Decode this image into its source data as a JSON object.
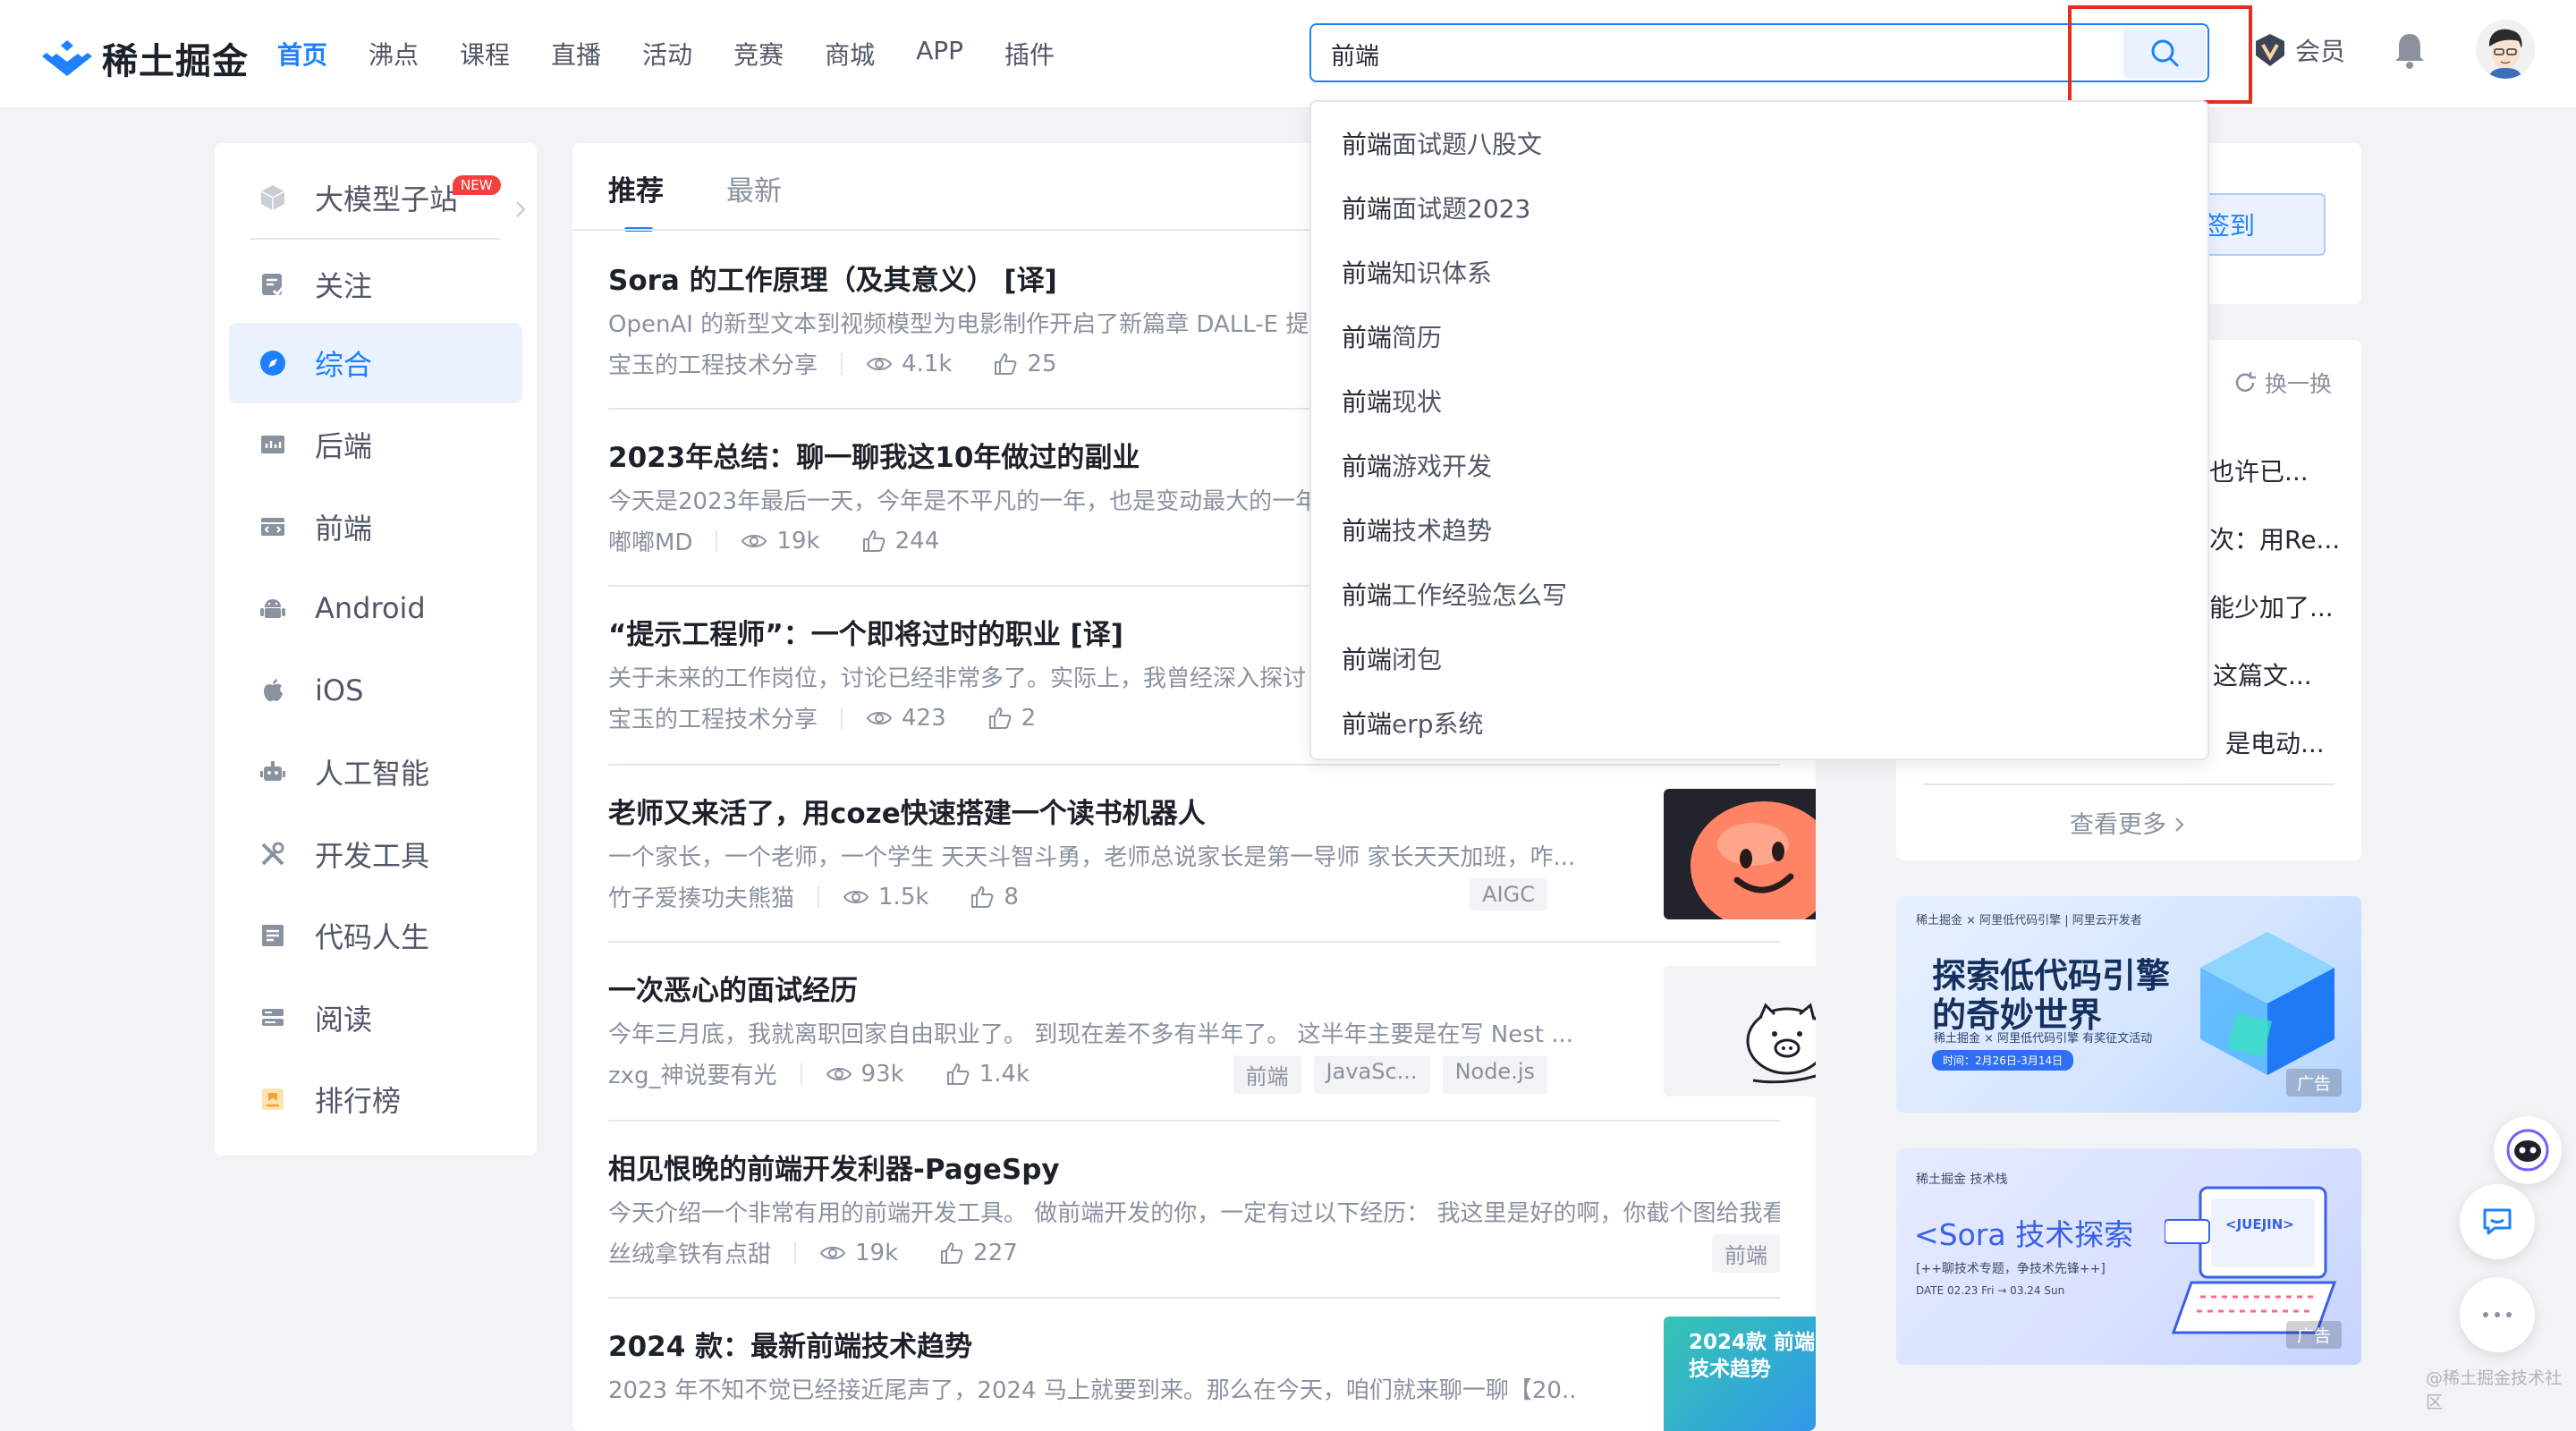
{
  "brand": {
    "name": "稀土掘金",
    "accent": "#1e80ff"
  },
  "nav": {
    "items": [
      {
        "label": "首页",
        "active": true
      },
      {
        "label": "沸点"
      },
      {
        "label": "课程"
      },
      {
        "label": "直播"
      },
      {
        "label": "活动"
      },
      {
        "label": "竞赛"
      },
      {
        "label": "商城"
      },
      {
        "label": "APP"
      },
      {
        "label": "插件"
      }
    ],
    "vip_label": "会员"
  },
  "search": {
    "value": "前端"
  },
  "suggestions": [
    {
      "prefix": "前端",
      "rest": "面试题八股文"
    },
    {
      "prefix": "前端",
      "rest": "面试题2023"
    },
    {
      "prefix": "前端",
      "rest": "知识体系"
    },
    {
      "prefix": "前端",
      "rest": "简历"
    },
    {
      "prefix": "前端",
      "rest": "现状"
    },
    {
      "prefix": "前端",
      "rest": "游戏开发"
    },
    {
      "prefix": "前端",
      "rest": "技术趋势"
    },
    {
      "prefix": "前端",
      "rest": "工作经验怎么写"
    },
    {
      "prefix": "前端",
      "rest": "闭包"
    },
    {
      "prefix": "前端",
      "rest": "erp系统"
    }
  ],
  "sidebar": {
    "items": [
      {
        "label": "大模型子站",
        "badge": "NEW",
        "icon": "cube-icon"
      },
      {
        "label": "关注",
        "icon": "follow-icon"
      },
      {
        "label": "综合",
        "icon": "compass-icon",
        "active": true
      },
      {
        "label": "后端",
        "icon": "backend-icon"
      },
      {
        "label": "前端",
        "icon": "frontend-icon"
      },
      {
        "label": "Android",
        "icon": "android-icon"
      },
      {
        "label": "iOS",
        "icon": "apple-icon"
      },
      {
        "label": "人工智能",
        "icon": "robot-icon"
      },
      {
        "label": "开发工具",
        "icon": "tools-icon"
      },
      {
        "label": "代码人生",
        "icon": "code-life-icon"
      },
      {
        "label": "阅读",
        "icon": "reading-icon"
      },
      {
        "label": "排行榜",
        "icon": "ranking-icon"
      }
    ]
  },
  "feed": {
    "tabs": [
      {
        "label": "推荐",
        "active": true
      },
      {
        "label": "最新"
      }
    ],
    "articles": [
      {
        "title": "Sora 的工作原理（及其意义） [译]",
        "desc": "OpenAI 的新型文本到视频模型为电影制作开启了新篇章 DALL-E 提供",
        "author": "宝玉的工程技术分享",
        "views": "4.1k",
        "likes": "25",
        "tags": []
      },
      {
        "title": "2023年总结：聊一聊我这10年做过的副业",
        "desc": "今天是2023年最后一天，今年是不平凡的一年，也是变动最大的一年",
        "author": "嘟嘟MD",
        "views": "19k",
        "likes": "244",
        "tags": []
      },
      {
        "title": "“提示工程师”：一个即将过时的职业 [译]",
        "desc": "关于未来的工作岗位，讨论已经非常多了。实际上，我曾经深入探讨",
        "author": "宝玉的工程技术分享",
        "views": "423",
        "likes": "2",
        "tags": []
      },
      {
        "title": "老师又来活了，用coze快速搭建一个读书机器人",
        "desc": "一个家长，一个老师，一个学生 天天斗智斗勇，老师总说家长是第一导师 家长天天加班，咋...",
        "author": "竹子爱揍功夫熊猫",
        "views": "1.5k",
        "likes": "8",
        "tags": [
          "AIGC"
        ]
      },
      {
        "title": "一次恶心的面试经历",
        "desc": "今年三月底，我就离职回家自由职业了。 到现在差不多有半年了。 这半年主要是在写 Nest ...",
        "author": "zxg_神说要有光",
        "views": "93k",
        "likes": "1.4k",
        "tags": [
          "前端",
          "JavaSc...",
          "Node.js"
        ]
      },
      {
        "title": "相见恨晚的前端开发利器-PageSpy",
        "desc": "今天介绍一个非常有用的前端开发工具。 做前端开发的你，一定有过以下经历： 我这里是好的啊，你截个图给我看...",
        "author": "丝绒拿铁有点甜",
        "views": "19k",
        "likes": "227",
        "tags": [
          "前端"
        ]
      },
      {
        "title": "2024 款：最新前端技术趋势",
        "desc": "2023 年不知不觉已经接近尾声了，2024 马上就要到来。那么在今天，咱们就来聊一聊【20...",
        "author": "",
        "views": "",
        "likes": "",
        "tags": []
      }
    ],
    "thumb5_text": "2024款 前端技术趋势"
  },
  "right": {
    "checkin_label": "去签到",
    "refresh_label": "换一换",
    "authors": [
      "也许已...",
      "次：用Re...",
      "能少加了...",
      "这篇文...",
      "是电动..."
    ],
    "more_label": "查看更多",
    "ad1": {
      "brand": "稀土掘金 × 阿里低代码引擎 | 阿里云开发者",
      "title1": "探索低代码引擎",
      "title2": "的奇妙世界",
      "sub": "稀土掘金 × 阿里低代码引擎 有奖征文活动",
      "time": "时间：2月26日-3月14日",
      "badge": "广告"
    },
    "ad2": {
      "brand": "稀土掘金 技术栈",
      "title": "<Sora 技术探索",
      "sub": "[++聊技术专题，争技术先锋++]",
      "date": "DATE   02.23 Fri → 03.24 Sun",
      "jj": "<JUEJIN>",
      "badge": "广告"
    }
  },
  "watermark": "@稀土掘金技术社区"
}
